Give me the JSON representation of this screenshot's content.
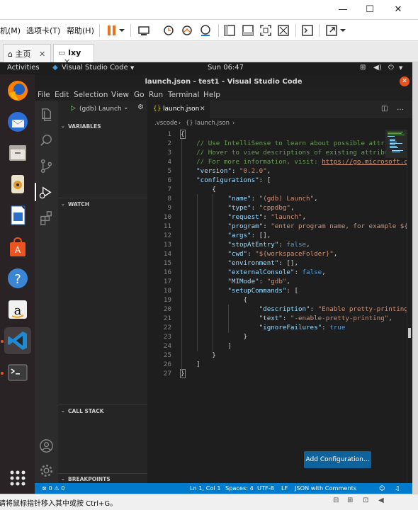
{
  "host": {
    "menu": [
      "机(M)",
      "选项卡(T)",
      "帮助(H)"
    ],
    "window_buttons": [
      "—",
      "☐",
      "✕"
    ],
    "tabs": [
      {
        "label": "主页"
      },
      {
        "label": "lxy"
      }
    ],
    "status_text": "请将鼠标指针移入其中或按 Ctrl+G。"
  },
  "ubuntu": {
    "activities": "Activities",
    "app_name": "Visual Studio Code",
    "clock": "Sun 06:47"
  },
  "vscode": {
    "title": "launch.json - test1 - Visual Studio Code",
    "menu": [
      "File",
      "Edit",
      "Selection",
      "View",
      "Go",
      "Run",
      "Terminal",
      "Help"
    ],
    "debug_config": "(gdb) Launch",
    "sections": {
      "variables": "VARIABLES",
      "watch": "WATCH",
      "call_stack": "CALL STACK",
      "breakpoints": "BREAKPOINTS"
    },
    "tab_label": "launch.json",
    "breadcrumb": [
      ".vscode",
      "{} launch.json"
    ],
    "line_numbers": [
      "1",
      "2",
      "3",
      "4",
      "5",
      "6",
      "7",
      "8",
      "9",
      "10",
      "11",
      "12",
      "13",
      "14",
      "15",
      "16",
      "17",
      "18",
      "19",
      "20",
      "21",
      "22",
      "23",
      "24",
      "25",
      "26",
      "27"
    ],
    "add_config_label": "Add Configuration...",
    "status": {
      "problems": "⊗ 0 ⚠ 0",
      "position": "Ln 1, Col 1",
      "spaces": "Spaces: 4",
      "encoding": "UTF-8",
      "eol": "LF",
      "language": "JSON with Comments"
    }
  },
  "colors": {
    "vscode_blue": "#007acc",
    "ubuntu_orange": "#e95420",
    "editor_bg": "#1e1e1e"
  }
}
